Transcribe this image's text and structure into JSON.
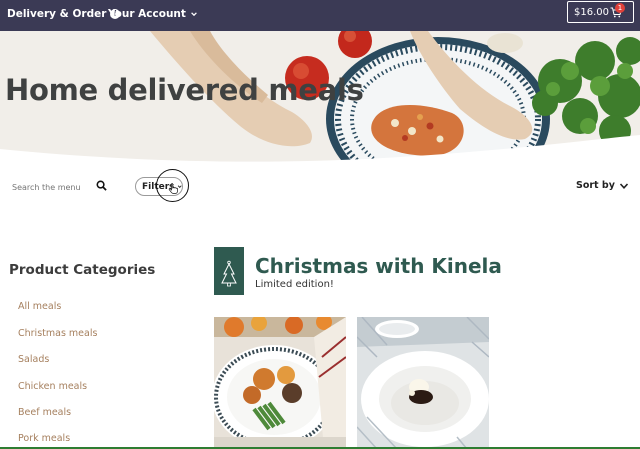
{
  "topbar": {
    "delivery_label": "Delivery & Order",
    "account_label": "Your Account",
    "cart_total": "$16.00",
    "cart_count": "1"
  },
  "hero": {
    "title": "Home delivered meals"
  },
  "toolbar": {
    "search_placeholder": "Search the menu",
    "filters_label": "Filters",
    "sort_label": "Sort by"
  },
  "sidebar": {
    "heading": "Product Categories",
    "items": [
      {
        "label": "All meals"
      },
      {
        "label": "Christmas meals"
      },
      {
        "label": "Salads"
      },
      {
        "label": "Chicken meals"
      },
      {
        "label": "Beef meals"
      },
      {
        "label": "Pork meals"
      }
    ]
  },
  "section": {
    "title": "Christmas with Kinela",
    "subtitle": "Limited edition!"
  },
  "colors": {
    "topbar": "#3b3a55",
    "accent_green": "#2f5a50",
    "category_link": "#a6805f",
    "cart_badge": "#e0413a"
  },
  "icons": [
    "info-icon",
    "chevron-down-icon",
    "cart-icon",
    "search-icon",
    "hand-cursor-icon",
    "christmas-tree-icon"
  ]
}
